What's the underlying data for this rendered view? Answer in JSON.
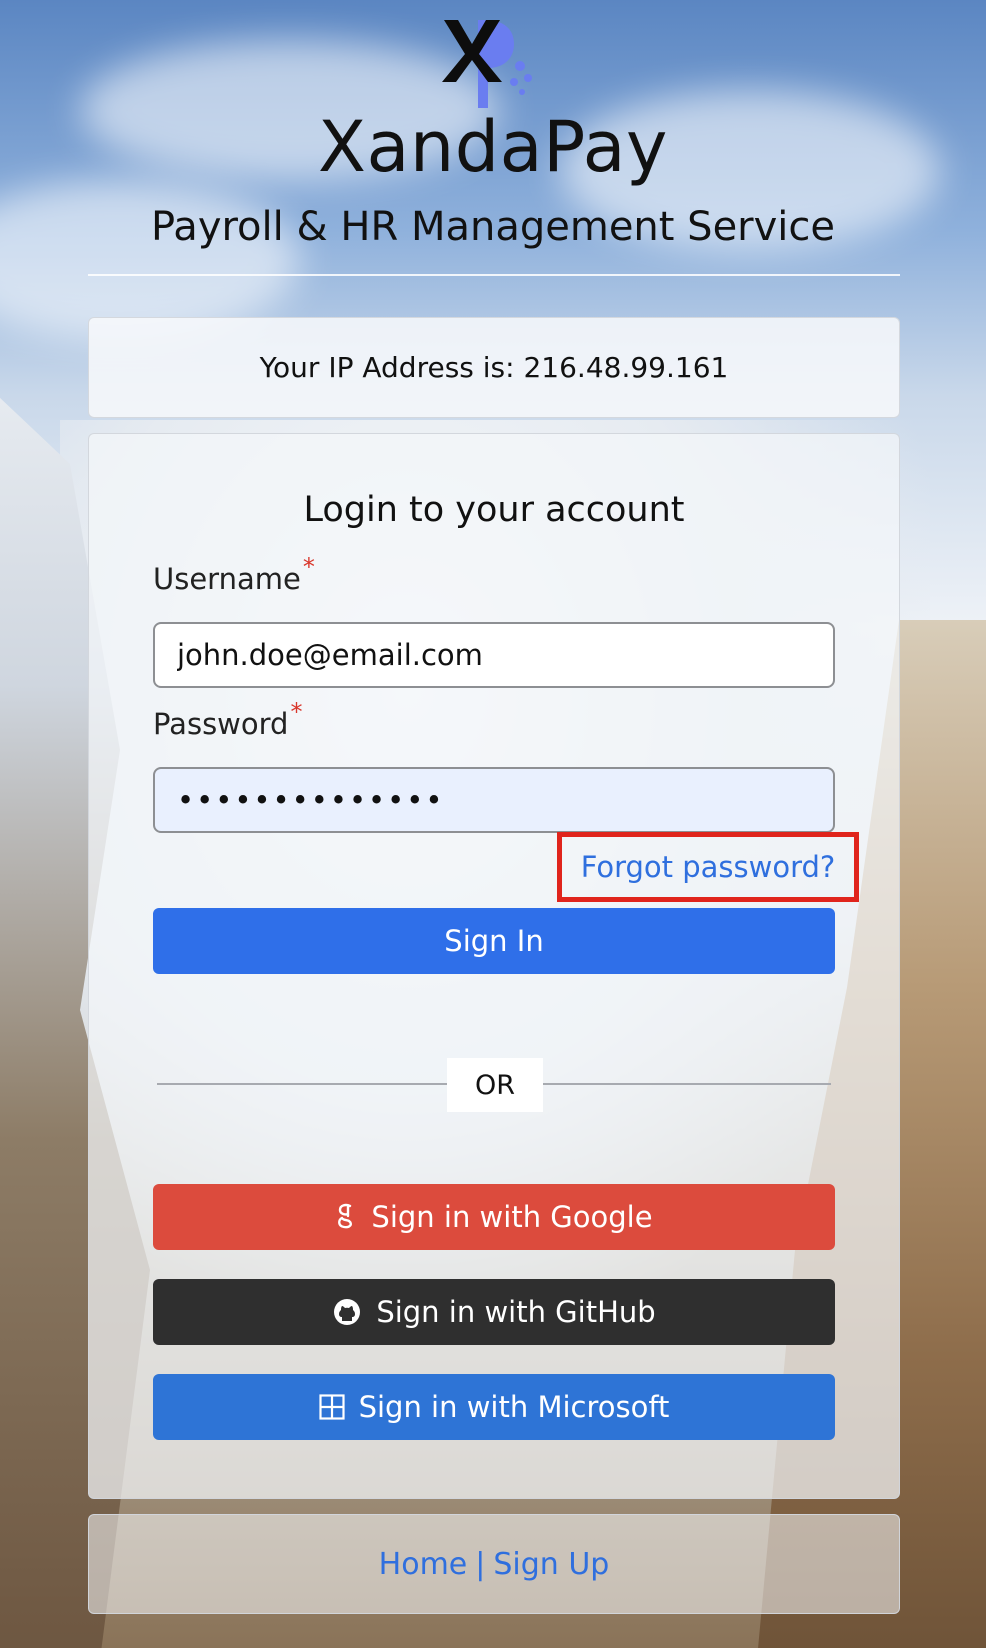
{
  "brand": {
    "name": "XandaPay",
    "tagline": "Payroll & HR Management Service",
    "logo_text": "XP"
  },
  "ip_notice": "Your IP Address is: 216.48.99.161",
  "login": {
    "title": "Login to your account",
    "username_label": "Username",
    "username_value": "john.doe@email.com",
    "password_label": "Password",
    "password_value": "••••••••••••••",
    "required_marker": "*",
    "forgot_label": "Forgot password?",
    "signin_label": "Sign In",
    "or_label": "OR",
    "google_label": "Sign in with Google",
    "github_label": "Sign in with GitHub",
    "microsoft_label": "Sign in with Microsoft"
  },
  "footer": {
    "home_label": "Home",
    "separator": "|",
    "signup_label": "Sign Up"
  },
  "colors": {
    "accent_blue": "#2f6fe9",
    "google_red": "#dc4b3d",
    "github_dark": "#2f2f2f",
    "microsoft_blue": "#2e74d6",
    "highlight_red": "#e0241c",
    "logo_p": "#6a7df0"
  },
  "icons": {
    "google": "google-icon",
    "github": "github-icon",
    "microsoft": "microsoft-icon"
  }
}
